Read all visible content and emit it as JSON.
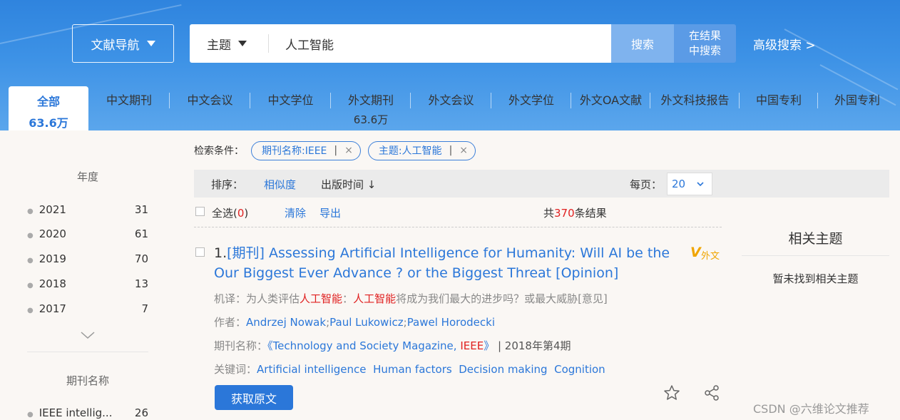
{
  "header": {
    "nav_label": "文献导航",
    "field_label": "主题",
    "query": "人工智能",
    "search_label": "搜索",
    "in_results_line1": "在结果",
    "in_results_line2": "中搜索",
    "advanced_label": "高级搜索 >"
  },
  "tabs": [
    {
      "label": "全部",
      "count": "63.6万"
    },
    {
      "label": "中文期刊",
      "count": ""
    },
    {
      "label": "中文会议",
      "count": ""
    },
    {
      "label": "中文学位",
      "count": ""
    },
    {
      "label": "外文期刊",
      "count": "63.6万"
    },
    {
      "label": "外文会议",
      "count": ""
    },
    {
      "label": "外文学位",
      "count": ""
    },
    {
      "label": "外文OA文献",
      "count": ""
    },
    {
      "label": "外文科技报告",
      "count": ""
    },
    {
      "label": "中国专利",
      "count": ""
    },
    {
      "label": "外国专利",
      "count": ""
    }
  ],
  "sidebar": {
    "year_title": "年度",
    "years": [
      {
        "year": "2021",
        "count": "31"
      },
      {
        "year": "2020",
        "count": "61"
      },
      {
        "year": "2019",
        "count": "70"
      },
      {
        "year": "2018",
        "count": "13"
      },
      {
        "year": "2017",
        "count": "7"
      }
    ],
    "journal_title": "期刊名称",
    "journals": [
      {
        "name": "IEEE intellig...",
        "count": "26"
      }
    ]
  },
  "conditions": {
    "label": "检索条件：",
    "filters": [
      {
        "text": "期刊名称:IEEE",
        "pipe": "|",
        "remove": "×"
      },
      {
        "text": "主题:人工智能",
        "pipe": "|",
        "remove": "×"
      }
    ]
  },
  "sort": {
    "label": "排序：",
    "relevance": "相似度",
    "date": "出版时间 ↓",
    "per_page_label": "每页：",
    "per_page_value": "20"
  },
  "toolbar": {
    "select_all": "全选",
    "paren_open": "(",
    "selected_count": "0",
    "paren_close": ")",
    "clear": "清除",
    "export": "导出",
    "total_prefix": "共",
    "total": "370",
    "total_suffix": "条结果"
  },
  "result": {
    "index": "1.",
    "type": "[期刊]",
    "title": "Assessing Artificial Intelligence for Humanity: Will AI be the Our Biggest Ever Advance ? or the Biggest Threat [Opinion]",
    "badge_v": "V",
    "badge_w": "外文",
    "translation_label": "机译：",
    "translation_parts": [
      "为人类评估",
      "人工智能",
      "：",
      "人工智能",
      "将成为我们最大的进步吗？或最大威胁[意见]"
    ],
    "authors_label": "作者：",
    "authors": [
      "Andrzej Nowak",
      "Paul Lukowicz",
      "Pawel Horodecki"
    ],
    "author_sep": ";",
    "journal_label": "期刊名称：",
    "journal_open": "《Technology and Society Magazine, ",
    "journal_hl": "IEEE",
    "journal_close": "》",
    "issue": " | 2018年第4期",
    "keywords_label": "关键词：",
    "keywords": [
      "Artificial intelligence",
      "Human factors",
      "Decision making",
      "Cognition"
    ],
    "get_button": "获取原文"
  },
  "related": {
    "title": "相关主题",
    "empty": "暂未找到相关主题"
  },
  "watermark": "CSDN @六维论文推荐",
  "colors": {
    "primary": "#2b77d9",
    "highlight": "#e02020",
    "badge": "#f0a500",
    "banner": "#3d92e6"
  }
}
